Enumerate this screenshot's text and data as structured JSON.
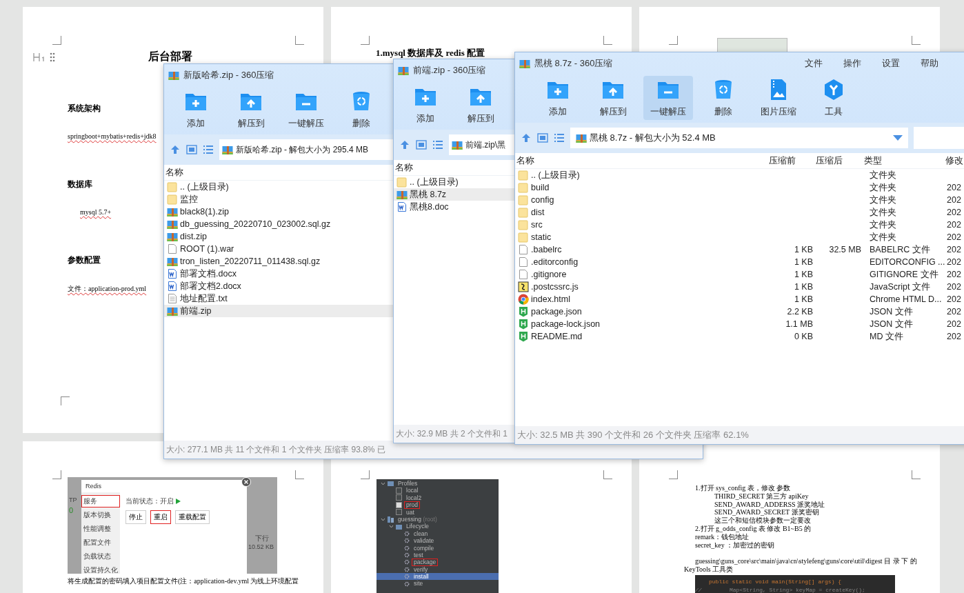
{
  "document": {
    "pages": [
      {
        "kind": "intro",
        "heading": "后台部署",
        "sections": [
          {
            "title": "系统架构",
            "text": "springboot+mybatis+redis+jdk8",
            "indent": false
          },
          {
            "title": "数据库",
            "text": "mysql 5.7+",
            "indent": true
          },
          {
            "title": "参数配置",
            "text": "文件：application-prod.yml",
            "indent": false
          }
        ]
      },
      {
        "kind": "heading",
        "heading": "1.mysql 数据库及 redis 配置"
      },
      {
        "kind": "thumbnail"
      },
      {
        "kind": "redis",
        "screenshot": {
          "title": "Redis",
          "menu": [
            {
              "label": "服务",
              "selected": true
            },
            {
              "label": "版本切换",
              "selected": false
            },
            {
              "label": "性能调整",
              "selected": false
            },
            {
              "label": "配置文件",
              "selected": false
            },
            {
              "label": "负载状态",
              "selected": false
            },
            {
              "label": "设置持久化",
              "selected": false
            }
          ],
          "status": "当前状态：开启",
          "buttons": [
            {
              "label": "停止",
              "highlighted": false
            },
            {
              "label": "重启",
              "highlighted": true
            },
            {
              "label": "重载配置",
              "highlighted": false
            }
          ],
          "left_label": "TP",
          "left_value": "0",
          "right_label": "下行",
          "right_value": "10.52 KB"
        },
        "caption": "将生成配置的密码填入项目配置文件(注：application-dev.yml 为线上环境配置"
      },
      {
        "kind": "ide",
        "tree": [
          {
            "label": "Profiles",
            "kind": "group",
            "expanded": true,
            "selected": false,
            "highlighted": false,
            "children": [
              {
                "label": "local",
                "kind": "checkbox",
                "checked": false,
                "selected": false,
                "highlighted": false
              },
              {
                "label": "local2",
                "kind": "checkbox",
                "checked": false,
                "selected": false,
                "highlighted": false
              },
              {
                "label": "prod",
                "kind": "checkbox",
                "checked": true,
                "selected": false,
                "highlighted": true
              },
              {
                "label": "uat",
                "kind": "checkbox",
                "checked": false,
                "selected": false,
                "highlighted": false
              }
            ]
          },
          {
            "label": "guessing",
            "note": "(root)",
            "kind": "module",
            "expanded": true,
            "selected": false,
            "highlighted": false,
            "children": [
              {
                "label": "Lifecycle",
                "kind": "group",
                "expanded": true,
                "selected": false,
                "highlighted": false,
                "children": [
                  {
                    "label": "clean",
                    "kind": "goal",
                    "selected": false,
                    "highlighted": false
                  },
                  {
                    "label": "validate",
                    "kind": "goal",
                    "selected": false,
                    "highlighted": false
                  },
                  {
                    "label": "compile",
                    "kind": "goal",
                    "selected": false,
                    "highlighted": false
                  },
                  {
                    "label": "test",
                    "kind": "goal",
                    "selected": false,
                    "highlighted": false
                  },
                  {
                    "label": "package",
                    "kind": "goal",
                    "selected": false,
                    "highlighted": true
                  },
                  {
                    "label": "verify",
                    "kind": "goal",
                    "selected": false,
                    "highlighted": false
                  },
                  {
                    "label": "install",
                    "kind": "goal",
                    "selected": true,
                    "highlighted": false
                  },
                  {
                    "label": "site",
                    "kind": "goal",
                    "selected": false,
                    "highlighted": false
                  }
                ]
              }
            ]
          }
        ]
      },
      {
        "kind": "notes",
        "lines": [
          {
            "text": "1.打开 sys_config 表，修改 参数",
            "kind": "plain"
          },
          {
            "text": "THIRD_SECRET 第三方 apiKey",
            "kind": "indent"
          },
          {
            "text": "SEND_AWARD_ADDERSS 派奖地址",
            "kind": "indent"
          },
          {
            "text": "SEND_AWARD_SECRET 派奖密钥",
            "kind": "indent"
          },
          {
            "text": "这三个和短信模块参数一定要改",
            "kind": "indent"
          },
          {
            "text": "2.打开 g_odds_config 表 修改 B1~B5 的",
            "kind": "plain"
          },
          {
            "text": "remark：钱包地址",
            "kind": "plain"
          },
          {
            "text": "secret_key ：加密过的密钥",
            "kind": "plain"
          },
          {
            "text": "guessing\\guns_core\\src\\main\\java\\cn\\stylefeng\\guns\\core\\util\\digest 目 录 下 的",
            "kind": "gap"
          },
          {
            "text": "KeyTools 工具类",
            "kind": "outdent"
          }
        ],
        "code": [
          {
            "text": "public static void main(String[] args) {",
            "kind": "code"
          },
          {
            "gutter": "//",
            "text": "Map<String, String> keyMap = createKey();",
            "kind": "comment"
          }
        ]
      }
    ]
  },
  "windows": [
    {
      "title": "新版哈希.zip - 360压缩",
      "toolbar": [
        {
          "label": "添加",
          "kind": "add",
          "highlighted": false
        },
        {
          "label": "解压到",
          "kind": "extract",
          "highlighted": false
        },
        {
          "label": "一键解压",
          "kind": "oneclick",
          "highlighted": false
        },
        {
          "label": "删除",
          "kind": "delete",
          "highlighted": false
        }
      ],
      "address": "新版哈希.zip - 解包大小为 295.4 MB",
      "columns": [
        "名称"
      ],
      "rows": [
        {
          "name": ".. (上级目录)",
          "kind": "folder",
          "selected": false
        },
        {
          "name": "监控",
          "kind": "folder",
          "selected": false
        },
        {
          "name": "black8(1).zip",
          "kind": "archive",
          "selected": false
        },
        {
          "name": "db_guessing_20220710_023002.sql.gz",
          "kind": "archive",
          "selected": false
        },
        {
          "name": "dist.zip",
          "kind": "archive",
          "selected": false
        },
        {
          "name": "ROOT (1).war",
          "kind": "file",
          "selected": false
        },
        {
          "name": "tron_listen_20220711_011438.sql.gz",
          "kind": "archive",
          "selected": false
        },
        {
          "name": "部署文档.docx",
          "kind": "word",
          "selected": false
        },
        {
          "name": "部署文档2.docx",
          "kind": "word",
          "selected": false
        },
        {
          "name": "地址配置.txt",
          "kind": "text",
          "selected": false
        },
        {
          "name": "前端.zip",
          "kind": "archive",
          "selected": true
        }
      ],
      "status": "大小: 277.1 MB 共 11 个文件和 1 个文件夹 压缩率 93.8% 已"
    },
    {
      "title": "前端.zip - 360压缩",
      "toolbar": [
        {
          "label": "添加",
          "kind": "add",
          "highlighted": false
        },
        {
          "label": "解压到",
          "kind": "extract",
          "highlighted": false
        }
      ],
      "address": "前端.zip\\黑",
      "columns": [
        "名称"
      ],
      "rows": [
        {
          "name": ".. (上级目录)",
          "kind": "folder",
          "selected": false
        },
        {
          "name": "黑桃 8.7z",
          "kind": "archive",
          "selected": true
        },
        {
          "name": "黑桃8.doc",
          "kind": "word",
          "selected": false
        }
      ],
      "status": "大小: 32.9 MB 共 2 个文件和 1"
    },
    {
      "title": "黑桃 8.7z - 360压缩",
      "menu": [
        "文件",
        "操作",
        "设置",
        "帮助"
      ],
      "toolbar": [
        {
          "label": "添加",
          "kind": "add",
          "highlighted": false
        },
        {
          "label": "解压到",
          "kind": "extract",
          "highlighted": false
        },
        {
          "label": "一键解压",
          "kind": "oneclick",
          "highlighted": true
        },
        {
          "label": "删除",
          "kind": "delete",
          "highlighted": false
        },
        {
          "label": "图片压缩",
          "kind": "image",
          "highlighted": false
        },
        {
          "label": "工具",
          "kind": "tools",
          "highlighted": false
        }
      ],
      "address": "黑桃 8.7z - 解包大小为 52.4 MB",
      "has_dropdown": true,
      "has_search": true,
      "columns": [
        "名称",
        "压缩前",
        "压缩后",
        "类型",
        "修改"
      ],
      "rows": [
        {
          "name": ".. (上级目录)",
          "kind": "folder",
          "selected": false,
          "type": "文件夹"
        },
        {
          "name": "build",
          "kind": "folder",
          "selected": false,
          "type": "文件夹",
          "modified": "202"
        },
        {
          "name": "config",
          "kind": "folder",
          "selected": false,
          "type": "文件夹",
          "modified": "202"
        },
        {
          "name": "dist",
          "kind": "folder",
          "selected": false,
          "type": "文件夹",
          "modified": "202"
        },
        {
          "name": "src",
          "kind": "folder",
          "selected": false,
          "type": "文件夹",
          "modified": "202"
        },
        {
          "name": "static",
          "kind": "folder",
          "selected": false,
          "type": "文件夹",
          "modified": "202"
        },
        {
          "name": ".babelrc",
          "kind": "file",
          "selected": false,
          "before": "1 KB",
          "after": "32.5 MB",
          "type": "BABELRC 文件",
          "modified": "202"
        },
        {
          "name": ".editorconfig",
          "kind": "file",
          "selected": false,
          "before": "1 KB",
          "type": "EDITORCONFIG ...",
          "modified": "202"
        },
        {
          "name": ".gitignore",
          "kind": "file",
          "selected": false,
          "before": "1 KB",
          "type": "GITIGNORE 文件",
          "modified": "202"
        },
        {
          "name": ".postcssrc.js",
          "kind": "script",
          "selected": false,
          "before": "1 KB",
          "type": "JavaScript 文件",
          "modified": "202"
        },
        {
          "name": "index.html",
          "kind": "browser",
          "selected": false,
          "before": "1 KB",
          "type": "Chrome HTML D...",
          "modified": "202"
        },
        {
          "name": "package.json",
          "kind": "json",
          "selected": false,
          "before": "2.2 KB",
          "type": "JSON 文件",
          "modified": "202"
        },
        {
          "name": "package-lock.json",
          "kind": "json",
          "selected": false,
          "before": "1.1 MB",
          "type": "JSON 文件",
          "modified": "202"
        },
        {
          "name": "README.md",
          "kind": "json",
          "selected": false,
          "before": "0 KB",
          "type": "MD 文件",
          "modified": "202"
        }
      ],
      "status": "大小: 32.5 MB 共 390 个文件和 26 个文件夹 压缩率 62.1%"
    }
  ]
}
